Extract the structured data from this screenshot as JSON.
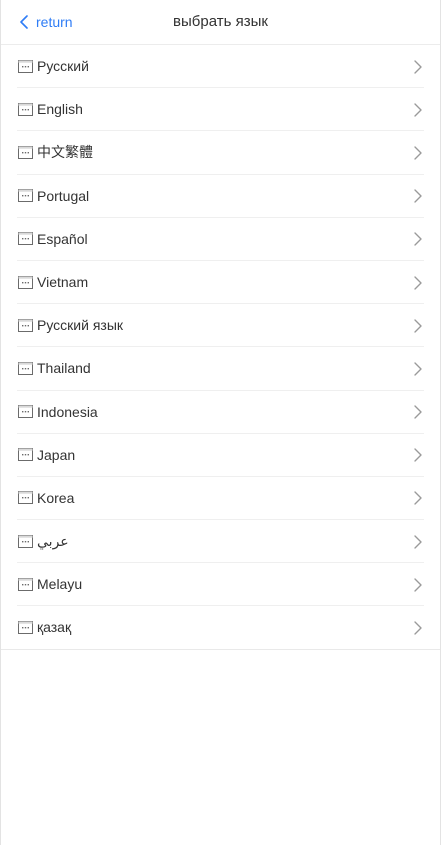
{
  "header": {
    "back_label": "return",
    "title": "выбрать язык"
  },
  "languages": [
    {
      "label": "Русский"
    },
    {
      "label": "English"
    },
    {
      "label": "中文繁體"
    },
    {
      "label": "Portugal"
    },
    {
      "label": "Español"
    },
    {
      "label": "Vietnam"
    },
    {
      "label": "Русский язык"
    },
    {
      "label": "Thailand"
    },
    {
      "label": "Indonesia"
    },
    {
      "label": "Japan"
    },
    {
      "label": "Korea"
    },
    {
      "label": "عربي"
    },
    {
      "label": "Melayu"
    },
    {
      "label": "қазақ"
    }
  ],
  "icons": {
    "back": "chevron-left-icon",
    "flag": "broken-image-icon",
    "row_arrow": "chevron-right-icon"
  },
  "colors": {
    "accent": "#2f7df6",
    "text": "#333333",
    "divider": "#efefef",
    "chevron": "#9a9a9a"
  }
}
